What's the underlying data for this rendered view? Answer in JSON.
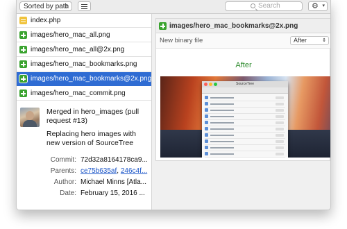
{
  "toolbar": {
    "sort_label": "Sorted by path",
    "search_placeholder": "Search",
    "gear_icon": "gear-icon",
    "list_icon": "list-view-icon"
  },
  "files": [
    {
      "name": "index.php",
      "status": "modified",
      "selected": false
    },
    {
      "name": "images/hero_mac_all.png",
      "status": "added",
      "selected": false
    },
    {
      "name": "images/hero_mac_all@2x.png",
      "status": "added",
      "selected": false
    },
    {
      "name": "images/hero_mac_bookmarks.png",
      "status": "added",
      "selected": false
    },
    {
      "name": "images/hero_mac_bookmarks@2x.png",
      "status": "added",
      "selected": true
    },
    {
      "name": "images/hero_mac_commit.png",
      "status": "added",
      "selected": false
    }
  ],
  "commit": {
    "title": "Merged in hero_images (pull request #13)",
    "body": "Replacing hero images with new version of SourceTree",
    "fields": {
      "commit_label": "Commit:",
      "commit_value": "72d32a8164178ca9...",
      "parents_label": "Parents:",
      "parent1": "ce75b635af",
      "parent_sep": ", ",
      "parent2": "246c4f...",
      "author_label": "Author:",
      "author_value": "Michael Minns [Atla...",
      "date_label": "Date:",
      "date_value": "February 15, 2016 ..."
    }
  },
  "diff": {
    "filename": "images/hero_mac_bookmarks@2x.png",
    "status_text": "New binary file",
    "view_option": "After",
    "image_label": "After",
    "preview_app_title": "SourceTree"
  },
  "colors": {
    "selection": "#2f6cd3",
    "added": "#3aa32f",
    "modified": "#f0c33c",
    "after_label": "#2e8b2e",
    "link": "#1a55c8"
  }
}
